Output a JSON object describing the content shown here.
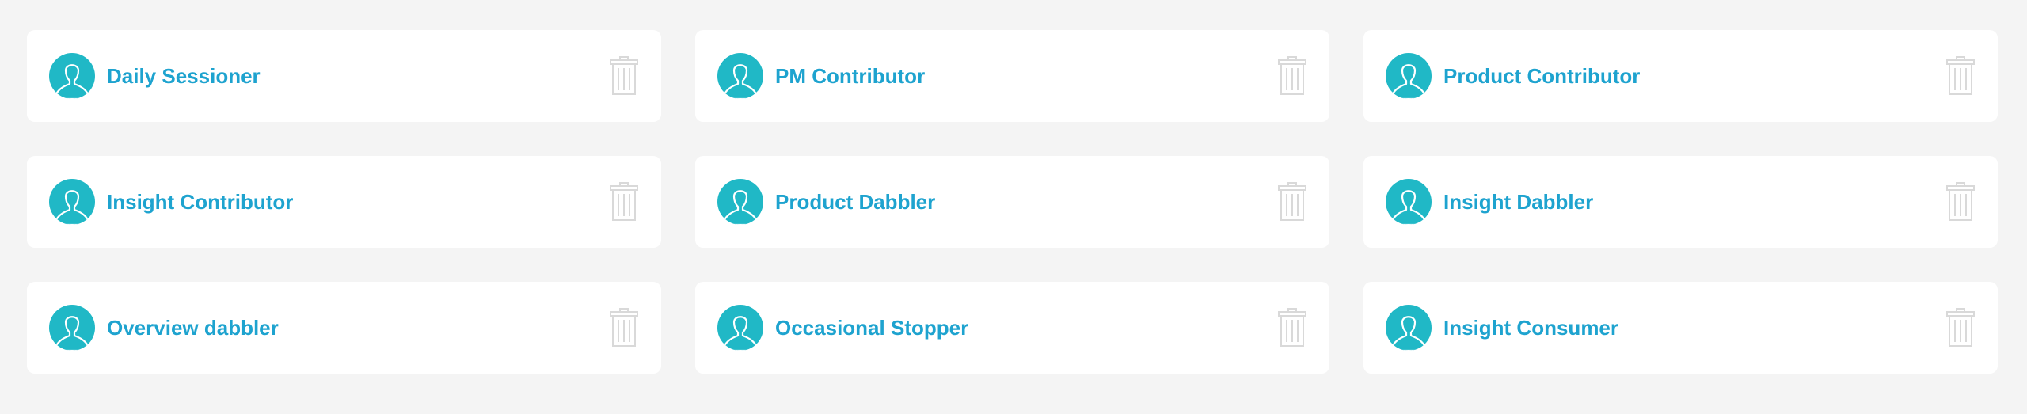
{
  "colors": {
    "background": "#f4f4f4",
    "card": "#ffffff",
    "avatar": "#20b8c6",
    "label": "#1ea3cf",
    "trash_icon": "#d9d9d9"
  },
  "icons": {
    "avatar": "user-silhouette-icon",
    "delete": "trash-icon"
  },
  "segments": [
    {
      "label": "Daily Sessioner"
    },
    {
      "label": "PM Contributor"
    },
    {
      "label": "Product Contributor"
    },
    {
      "label": "Insight Contributor"
    },
    {
      "label": "Product Dabbler"
    },
    {
      "label": "Insight Dabbler"
    },
    {
      "label": "Overview dabbler"
    },
    {
      "label": "Occasional Stopper"
    },
    {
      "label": "Insight Consumer"
    }
  ]
}
